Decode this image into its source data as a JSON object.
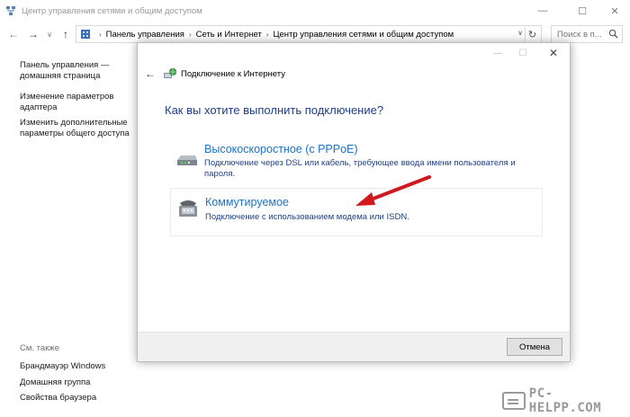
{
  "window": {
    "title": "Центр управления сетями и общим доступом",
    "min_glyph": "—",
    "max_glyph": "☐",
    "close_glyph": "✕"
  },
  "nav": {
    "back_glyph": "←",
    "forward_glyph": "→",
    "dropdown_glyph": "∨",
    "up_glyph": "↑",
    "refresh_glyph": "↻",
    "breadcrumbs": [
      "Панель управления",
      "Сеть и Интернет",
      "Центр управления сетями и общим доступом"
    ],
    "crumb_separator": "›",
    "search_placeholder": "Поиск в п..."
  },
  "left_panel": {
    "links": [
      "Панель управления —\nдомашняя страница",
      "Изменение параметров\nадаптера",
      "Изменить дополнительные\nпараметры общего доступа"
    ],
    "see_also_label": "См. также",
    "see_also_links": [
      "Брандмауэр Windows",
      "Домашняя группа",
      "Свойства браузера"
    ]
  },
  "dialog": {
    "title": "Подключение к Интернету",
    "back_glyph": "←",
    "min_glyph": "—",
    "max_glyph": "☐",
    "close_glyph": "✕",
    "heading": "Как вы хотите выполнить подключение?",
    "options": [
      {
        "title": "Высокоскоростное (с PPPoE)",
        "description": "Подключение через DSL или кабель, требующее ввода имени пользователя и пароля.",
        "icon": "broadband-modem-icon"
      },
      {
        "title": "Коммутируемое",
        "description": "Подключение с использованием модема или ISDN.",
        "icon": "dialup-phone-icon"
      }
    ],
    "cancel_label": "Отмена"
  },
  "watermark": {
    "text": "PC-HELPP.COM"
  },
  "colors": {
    "heading": "#1e3f88",
    "option_title": "#1a73c6",
    "annotation_arrow": "#d0181f"
  }
}
